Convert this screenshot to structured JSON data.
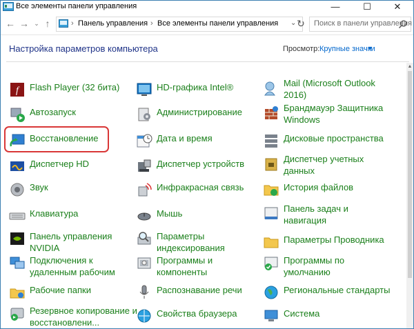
{
  "window": {
    "title": "Все элементы панели управления"
  },
  "nav": {
    "breadcrumb": [
      "Панель управления",
      "Все элементы панели управления"
    ],
    "search_placeholder": "Поиск в панели управления"
  },
  "header": {
    "title": "Настройка параметров компьютера",
    "view_label": "Просмотр:",
    "view_value": "Крупные значки"
  },
  "items": [
    {
      "label": "Flash Player (32 бита)",
      "icon": "flash-player-icon"
    },
    {
      "label": "HD-графика Intel®",
      "icon": "intel-graphics-icon"
    },
    {
      "label": "Mail (Microsoft Outlook\n2016)",
      "icon": "mail-icon"
    },
    {
      "label": "Автозапуск",
      "icon": "autoplay-icon"
    },
    {
      "label": "Администрирование",
      "icon": "admin-tools-icon"
    },
    {
      "label": "Брандмауэр Защитника\nWindows",
      "icon": "firewall-icon"
    },
    {
      "label": "Восстановление",
      "icon": "recovery-icon"
    },
    {
      "label": "Дата и время",
      "icon": "date-time-icon"
    },
    {
      "label": "Дисковые пространства",
      "icon": "storage-spaces-icon"
    },
    {
      "label": "Диспетчер HD",
      "icon": "hd-manager-icon"
    },
    {
      "label": "Диспетчер устройств",
      "icon": "device-manager-icon"
    },
    {
      "label": "Диспетчер учетных\nданных",
      "icon": "credential-manager-icon"
    },
    {
      "label": "Звук",
      "icon": "sound-icon"
    },
    {
      "label": "Инфракрасная связь",
      "icon": "infrared-icon"
    },
    {
      "label": "История файлов",
      "icon": "file-history-icon"
    },
    {
      "label": "Клавиатура",
      "icon": "keyboard-icon"
    },
    {
      "label": "Мышь",
      "icon": "mouse-icon"
    },
    {
      "label": "Панель задач и\nнавигация",
      "icon": "taskbar-icon"
    },
    {
      "label": "Панель управления\nNVIDIA",
      "icon": "nvidia-icon"
    },
    {
      "label": "Параметры\nиндексирования",
      "icon": "indexing-icon"
    },
    {
      "label": "Параметры Проводника",
      "icon": "explorer-options-icon"
    },
    {
      "label": "Подключения к\nудаленным рабочим",
      "icon": "remote-desktop-icon"
    },
    {
      "label": "Программы и\nкомпоненты",
      "icon": "programs-icon"
    },
    {
      "label": "Программы по\nумолчанию",
      "icon": "default-programs-icon"
    },
    {
      "label": "Рабочие папки",
      "icon": "work-folders-icon"
    },
    {
      "label": "Распознавание речи",
      "icon": "speech-icon"
    },
    {
      "label": "Региональные стандарты",
      "icon": "region-icon"
    },
    {
      "label": "Резервное копирование и\nвосстановлени...",
      "icon": "backup-icon"
    },
    {
      "label": "Свойства браузера",
      "icon": "internet-options-icon"
    },
    {
      "label": "Система",
      "icon": "system-icon"
    }
  ],
  "colors": {
    "link_green": "#1a7f1a",
    "title_blue": "#1e3287",
    "highlight_red": "#d93636"
  }
}
